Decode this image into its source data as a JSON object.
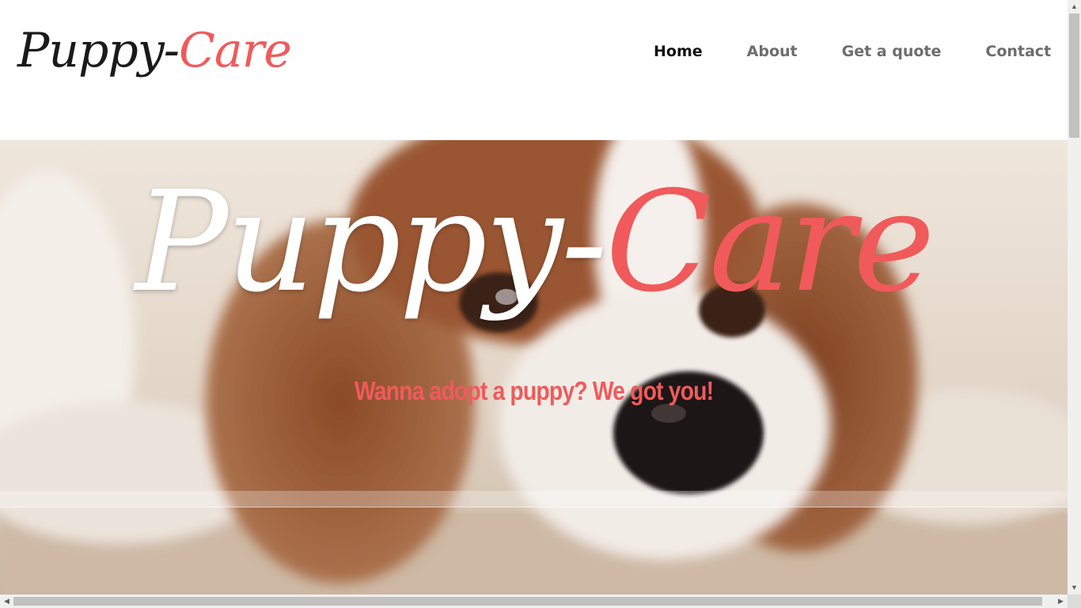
{
  "logo": {
    "word1": "Puppy-",
    "word2": "Care"
  },
  "nav": {
    "home": "Home",
    "about": "About",
    "quote": "Get a quote",
    "contact": "Contact"
  },
  "hero": {
    "title_word1": "Puppy-",
    "title_word2": "Care",
    "tagline": "Wanna adopt a puppy? We got you!"
  },
  "colors": {
    "accent": "#f05a5b",
    "nav_active": "#111111",
    "nav_inactive": "#6d6d6d"
  },
  "icons": {
    "scroll_up": "triangle-up",
    "scroll_down": "triangle-down",
    "scroll_left": "triangle-left",
    "scroll_right": "triangle-right"
  }
}
